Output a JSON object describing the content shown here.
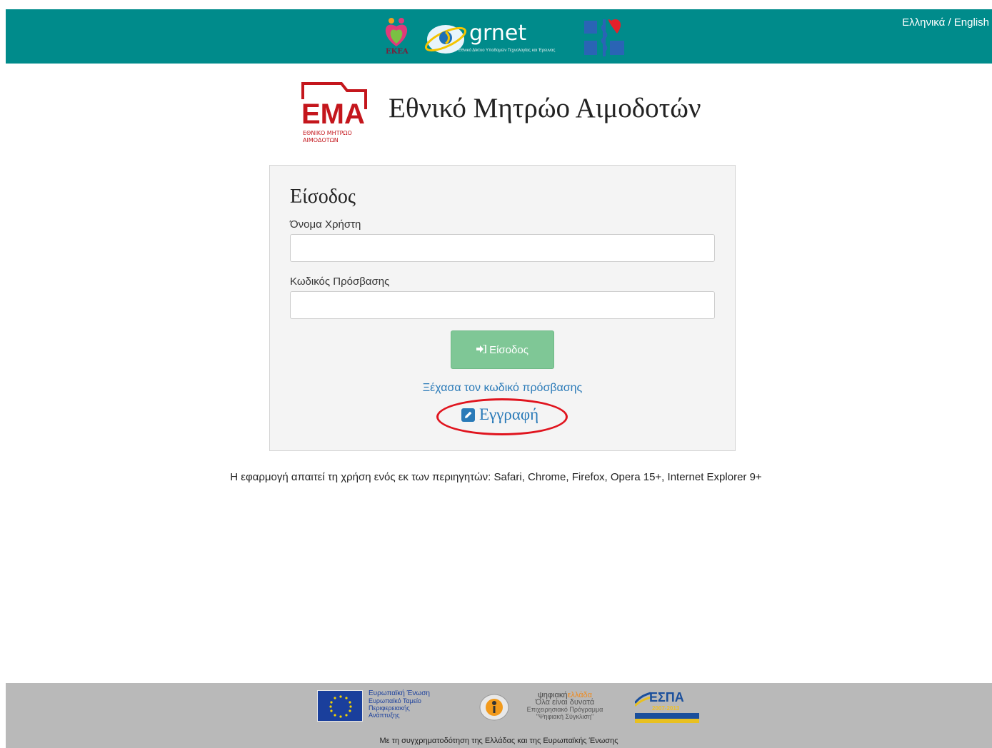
{
  "header": {
    "language_switch": "Ελληνικά / English",
    "lang_greek": "Ελληνικά",
    "lang_sep": " / ",
    "lang_english": "English",
    "ekea_logo_text": "ΕΚΕΑ",
    "grnet_logo_text": "grnet",
    "grnet_subtitle": "Εθνικό Δίκτυο Υποδομών Τεχνολογίας και Έρευνας"
  },
  "brand": {
    "title": "Εθνικό Μητρώο Αιμοδοτών",
    "logo_text": "ΕΜΑ",
    "logo_subtext_1": "ΕΘΝΙΚΟ ΜΗΤΡΩΟ",
    "logo_subtext_2": "ΑΙΜΟΔΟΤΩΝ"
  },
  "login": {
    "title": "Είσοδος",
    "username_label": "Όνομα Χρήστη",
    "username_value": "",
    "password_label": "Κωδικός Πρόσβασης",
    "password_value": "",
    "submit_label": "Είσοδος",
    "forgot_link": "Ξέχασα τον κωδικό πρόσβασης",
    "register_link": "Εγγραφή"
  },
  "browser_notice": "Η εφαρμογή απαιτεί τη χρήση ενός εκ των περιηγητών: Safari, Chrome, Firefox, Opera 15+, Internet Explorer 9+",
  "footer": {
    "eu_line1": "Ευρωπαϊκή Ένωση",
    "eu_line2": "Ευρωπαϊκό Ταμείο",
    "eu_line3": "Περιφερειακής",
    "eu_line4": "Ανάπτυξης",
    "digital_line1_a": "ψηφιακή",
    "digital_line1_b": "ελλάδα",
    "digital_line2": "Όλα είναι δυνατά",
    "digital_line3": "Επιχειρησιακό Πρόγραμμα",
    "digital_line4": "\"Ψηφιακή Σύγκλιση\"",
    "espa_title": "ΕΣΠΑ",
    "espa_years": "2007-2013",
    "caption": "Με τη συγχρηματοδότηση της Ελλάδας και της Ευρωπαϊκής Ένωσης"
  },
  "colors": {
    "header_bg": "#008b8b",
    "button_bg": "#7fc796",
    "link": "#2a7ab8",
    "highlight_ellipse": "#e0141e",
    "ema_red": "#c4161c"
  }
}
